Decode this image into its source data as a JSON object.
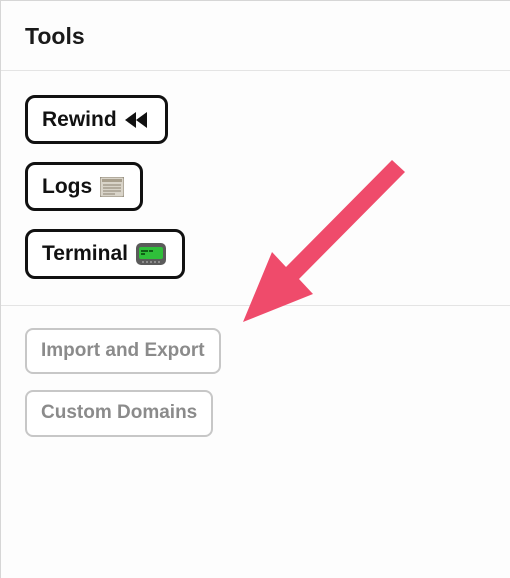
{
  "header": {
    "title": "Tools"
  },
  "primary_buttons": [
    {
      "label": "Rewind",
      "icon": "rewind-icon"
    },
    {
      "label": "Logs",
      "icon": "logs-icon"
    },
    {
      "label": "Terminal",
      "icon": "terminal-icon"
    }
  ],
  "secondary_buttons": [
    {
      "label": "Import and Export"
    },
    {
      "label": "Custom Domains"
    }
  ],
  "annotation": {
    "arrow_color": "#ef4b6b"
  }
}
